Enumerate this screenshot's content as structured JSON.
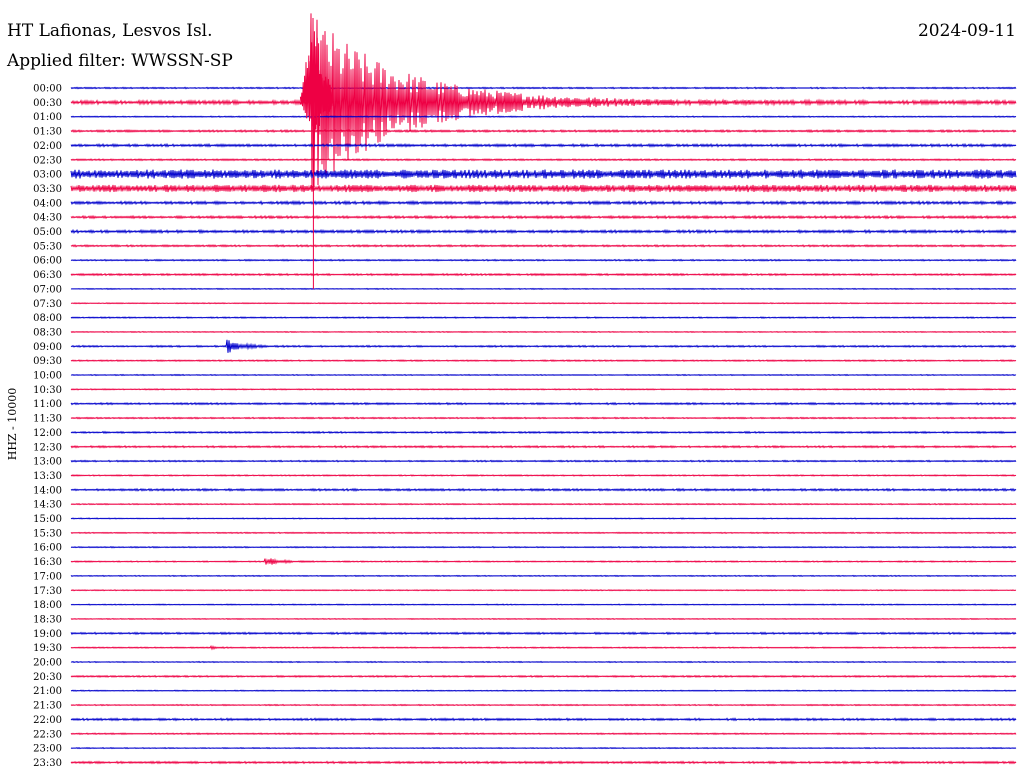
{
  "header": {
    "station": "HT Lafionas, Lesvos Isl.",
    "filter": "Applied filter: WWSSN-SP",
    "date": "2024-09-11"
  },
  "chart_data": {
    "type": "line",
    "title": "HT Lafionas, Lesvos Isl.",
    "subtitle": "Applied filter: WWSSN-SP",
    "date": "2024-09-11",
    "ylabel": "HHZ - 10000",
    "row_labels": [
      "00:00",
      "00:30",
      "01:00",
      "01:30",
      "02:00",
      "02:30",
      "03:00",
      "03:30",
      "04:00",
      "04:30",
      "05:00",
      "05:30",
      "06:00",
      "06:30",
      "07:00",
      "07:30",
      "08:00",
      "08:30",
      "09:00",
      "09:30",
      "10:00",
      "10:30",
      "11:00",
      "11:30",
      "12:00",
      "12:30",
      "13:00",
      "13:30",
      "14:00",
      "14:30",
      "15:00",
      "15:30",
      "16:00",
      "16:30",
      "17:00",
      "17:30",
      "18:00",
      "18:30",
      "19:00",
      "19:30",
      "20:00",
      "20:30",
      "21:00",
      "21:30",
      "22:00",
      "22:30",
      "23:00",
      "23:30"
    ],
    "trace_minutes_per_line": 30,
    "colors": [
      "#0000cc",
      "#ee0044"
    ],
    "noise_level": [
      0.7,
      1.8,
      0.6,
      1.0,
      1.2,
      0.8,
      4.5,
      3.6,
      1.4,
      1.2,
      1.3,
      0.9,
      0.7,
      0.9,
      0.5,
      0.5,
      0.6,
      0.5,
      0.8,
      0.7,
      0.5,
      0.6,
      0.9,
      0.7,
      0.8,
      0.9,
      0.7,
      0.6,
      1.0,
      0.6,
      0.5,
      0.6,
      0.6,
      0.6,
      0.5,
      0.5,
      0.5,
      0.5,
      0.9,
      0.6,
      0.5,
      0.8,
      0.5,
      0.6,
      1.0,
      0.7,
      0.5,
      1.0
    ],
    "events": [
      {
        "row": 1,
        "minute": 7.6,
        "amplitude": 90,
        "duration_min": 4.5
      },
      {
        "row": 18,
        "minute": 4.9,
        "amplitude": 7,
        "duration_min": 0.7
      },
      {
        "row": 33,
        "minute": 6.1,
        "amplitude": 5,
        "duration_min": 0.6
      },
      {
        "row": 5,
        "minute": 30.0,
        "amplitude": 5,
        "duration_min": 1.2
      },
      {
        "row": 39,
        "minute": 4.4,
        "amplitude": 2,
        "duration_min": 0.3
      }
    ]
  }
}
